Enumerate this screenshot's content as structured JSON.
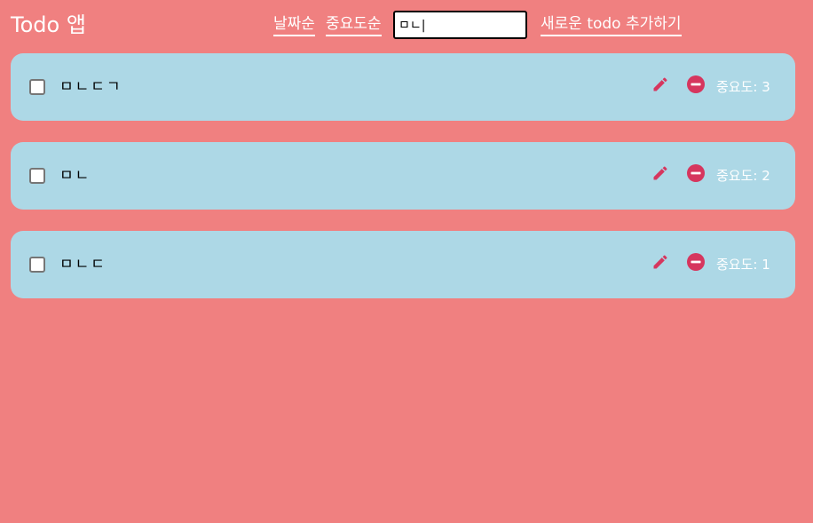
{
  "header": {
    "title": "Todo 앱",
    "sort_date_label": "날짜순",
    "sort_priority_label": "중요도순",
    "search_value": "ㅁㄴ|",
    "add_label": "새로운 todo 추가하기"
  },
  "todos": [
    {
      "text": "ㅁㄴㄷㄱ",
      "priority_label": "중요도: 3",
      "checked": false
    },
    {
      "text": "ㅁㄴ",
      "priority_label": "중요도: 2",
      "checked": false
    },
    {
      "text": "ㅁㄴㄷ",
      "priority_label": "중요도: 1",
      "checked": false
    }
  ],
  "icons": {
    "edit": "pencil-icon",
    "remove": "minus-circle-icon",
    "checkbox": "checkbox"
  },
  "colors": {
    "background": "#f08080",
    "card": "#add8e6",
    "icon": "#d6365e",
    "text_light": "#ffffff"
  }
}
